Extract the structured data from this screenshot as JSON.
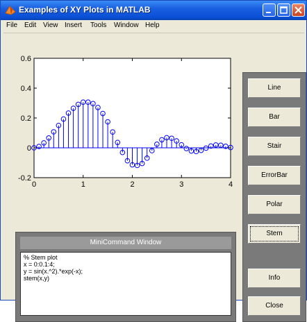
{
  "window": {
    "title": "Examples of XY Plots in MATLAB",
    "minimize_label": "minimize",
    "maximize_label": "maximize",
    "close_label": "close"
  },
  "menubar": {
    "items": [
      "File",
      "Edit",
      "View",
      "Insert",
      "Tools",
      "Window",
      "Help"
    ]
  },
  "buttons": {
    "line": "Line",
    "bar": "Bar",
    "stair": "Stair",
    "errorbar": "ErrorBar",
    "polar": "Polar",
    "stem": "Stem",
    "info": "Info",
    "close": "Close"
  },
  "mini_command_window": {
    "title": "MiniCommand Window",
    "lines": [
      "% Stem plot",
      "x = 0:0.1:4;",
      "y = sin(x.^2).*exp(-x);",
      "stem(x,y)"
    ]
  },
  "colors": {
    "stem": "#0000ff",
    "title_bar": "#0b4fd6",
    "panel": "#7a7a7a"
  },
  "chart_data": {
    "type": "stem",
    "xlim": [
      0,
      4
    ],
    "ylim": [
      -0.2,
      0.6
    ],
    "xticks": [
      "0",
      "1",
      "2",
      "3",
      "4"
    ],
    "yticks": [
      "-0.2",
      "0",
      "0.2",
      "0.4",
      "0.6"
    ],
    "x": [
      0,
      0.1,
      0.2,
      0.3,
      0.4,
      0.5,
      0.6,
      0.7,
      0.8,
      0.9,
      1.0,
      1.1,
      1.2,
      1.3,
      1.4,
      1.5,
      1.6,
      1.7,
      1.8,
      1.9,
      2.0,
      2.1,
      2.2,
      2.3,
      2.4,
      2.5,
      2.6,
      2.7,
      2.8,
      2.9,
      3.0,
      3.1,
      3.2,
      3.3,
      3.4,
      3.5,
      3.6,
      3.7,
      3.8,
      3.9,
      4.0
    ],
    "values": [
      0,
      0.009,
      0.033,
      0.066,
      0.107,
      0.15,
      0.193,
      0.233,
      0.265,
      0.291,
      0.306,
      0.306,
      0.296,
      0.27,
      0.23,
      0.174,
      0.106,
      0.036,
      -0.031,
      -0.087,
      -0.114,
      -0.118,
      -0.105,
      -0.069,
      -0.019,
      0.024,
      0.054,
      0.068,
      0.064,
      0.046,
      0.02,
      -0.005,
      -0.021,
      -0.025,
      -0.017,
      -0.002,
      0.012,
      0.019,
      0.017,
      0.01,
      0.002
    ],
    "title": "",
    "xlabel": "",
    "ylabel": "",
    "grid": false
  }
}
